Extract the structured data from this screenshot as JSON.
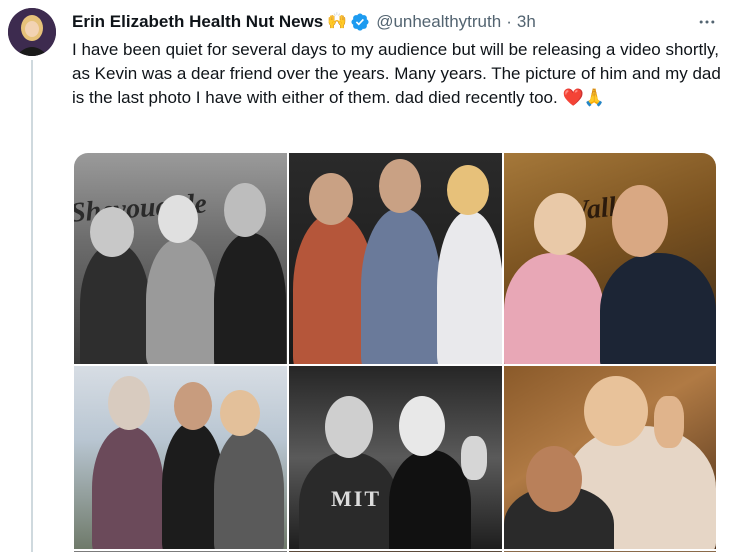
{
  "author": {
    "name": "Erin Elizabeth Health Nut News",
    "name_emoji": "🙌",
    "handle": "@unhealthytruth",
    "separator": "·",
    "time": "3h"
  },
  "tweet": {
    "text": "I have been quiet for several days to my audience but will be releasing a video shortly, as  Kevin was a dear friend over the years. Many years. The picture of him and my dad is the last photo I have with either of them. dad died recently too. ❤️🙏"
  },
  "photos": {
    "caption_1": "Sheyouarde",
    "caption_3": "Waller",
    "shirt_text": "MIT"
  },
  "colors": {
    "text": "#0f1419",
    "secondary": "#536471",
    "verified": "#1d9bf0",
    "thread_line": "#cfd9de"
  }
}
